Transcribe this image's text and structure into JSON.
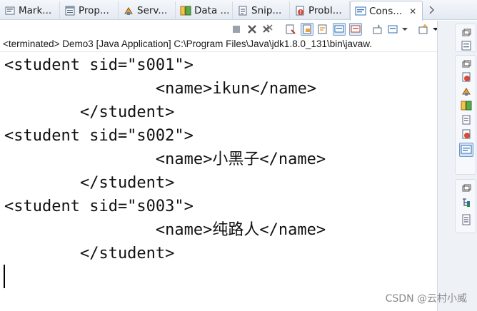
{
  "tabs": [
    {
      "label": "Mark...",
      "icon": "markers-icon",
      "active": false
    },
    {
      "label": "Prop...",
      "icon": "properties-icon",
      "active": false
    },
    {
      "label": "Serv...",
      "icon": "servers-icon",
      "active": false
    },
    {
      "label": "Data ...",
      "icon": "data-source-icon",
      "active": false
    },
    {
      "label": "Snip...",
      "icon": "snippets-icon",
      "active": false
    },
    {
      "label": "Probl...",
      "icon": "problems-icon",
      "active": false
    },
    {
      "label": "Cons...",
      "icon": "console-icon",
      "active": true,
      "close": "✕"
    }
  ],
  "status_line": "<terminated> Demo3 [Java Application] C:\\Program Files\\Java\\jdk1.8.0_131\\bin\\javaw.",
  "console_lines": [
    "<student sid=\"s001\">",
    "                <name>ikun</name>",
    "        </student>",
    "<student sid=\"s002\">",
    "                <name>小黑子</name>",
    "        </student>",
    "<student sid=\"s003\">",
    "                <name>纯路人</name>",
    "        </student>"
  ],
  "watermark": "CSDN @云村小威",
  "colors": {
    "accent": "#2f6fb5",
    "terminate_red": "#c83a2a",
    "tab_bg": "#e4eaf2"
  }
}
